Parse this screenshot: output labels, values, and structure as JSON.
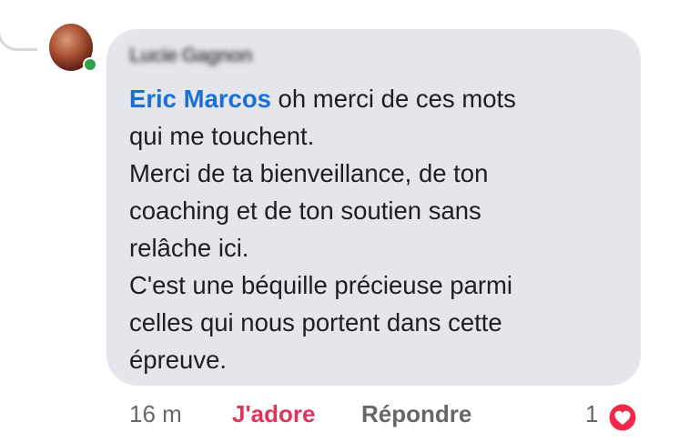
{
  "comment": {
    "author_name": "Lucie Gagnon",
    "mention": "Eric Marcos",
    "text_lines": [
      " oh merci de ces mots",
      "qui me touchent.",
      "Merci de ta bienveillance, de ton",
      "coaching et de ton soutien sans",
      "relâche ici.",
      "C'est une béquille précieuse parmi",
      "celles qui nous portent dans cette",
      "épreuve."
    ]
  },
  "actions": {
    "timestamp": "16 m",
    "like_label": "J'adore",
    "reply_label": "Répondre",
    "reaction_count": "1",
    "reaction_icon": "love-icon"
  },
  "colors": {
    "bubble": "#e5e6eb",
    "mention": "#1a6fd6",
    "like_active": "#e0345a",
    "love_reaction": "#f02849",
    "online": "#31a24c"
  }
}
